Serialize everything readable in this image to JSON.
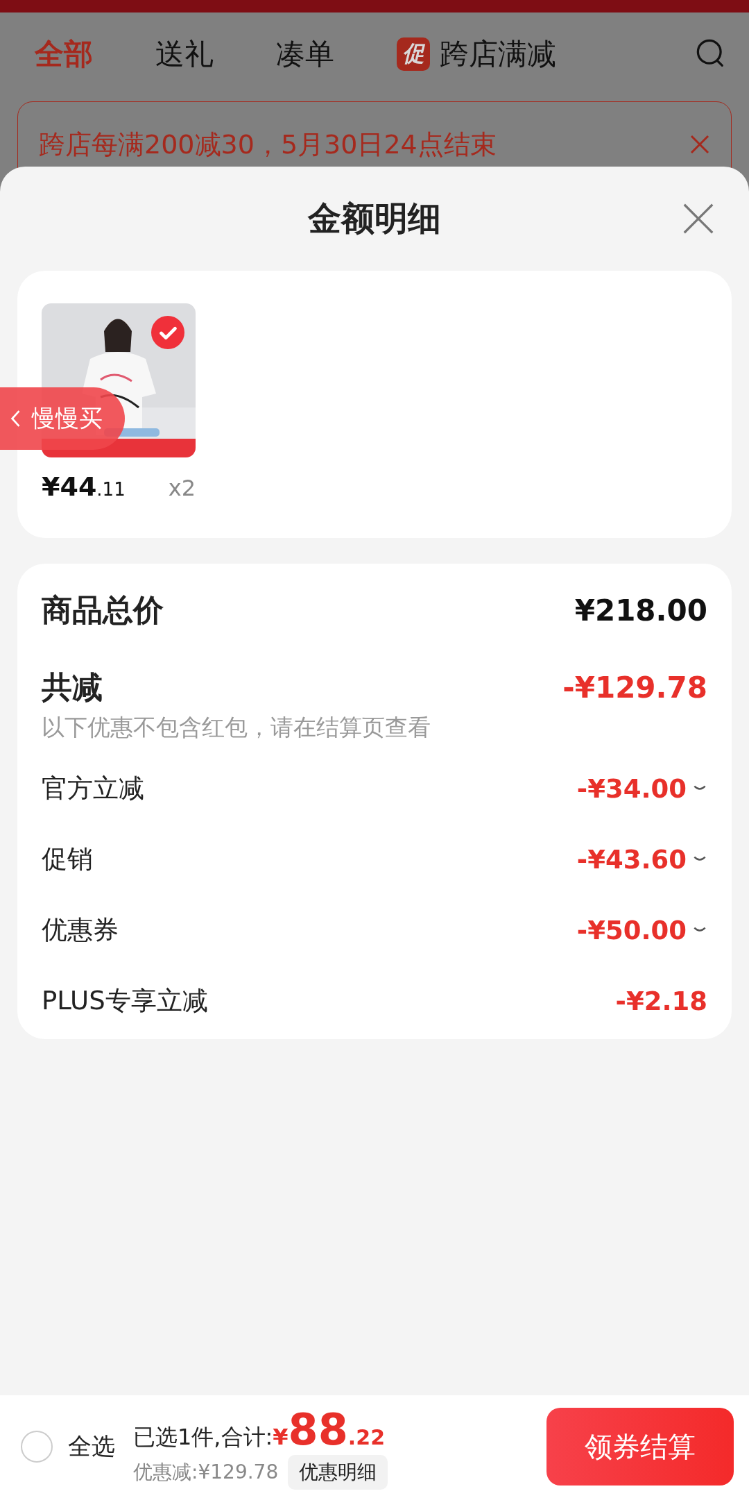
{
  "tabs": [
    {
      "label": "全部",
      "selected": true
    },
    {
      "label": "送礼",
      "selected": false
    },
    {
      "label": "凑单",
      "selected": false
    },
    {
      "label": "跨店满减",
      "selected": false,
      "badge": "促"
    }
  ],
  "promo_banner": {
    "text": "跨店每满200减30，5月30日24点结束"
  },
  "sheet": {
    "title": "金额明细",
    "product": {
      "checked": true,
      "price_main": "¥44",
      "price_decimal": ".11",
      "quantity": "x2",
      "side_tab": "慢慢买"
    },
    "summary": [
      {
        "kind": "total",
        "label": "商品总价",
        "value": "¥218.00"
      },
      {
        "kind": "discount_total",
        "label": "共减",
        "value": "-¥129.78",
        "note": "以下优惠不包含红包，请在结算页查看"
      },
      {
        "kind": "item",
        "label": "官方立减",
        "value": "-¥34.00",
        "expandable": true
      },
      {
        "kind": "item",
        "label": "促销",
        "value": "-¥43.60",
        "expandable": true
      },
      {
        "kind": "item",
        "label": "优惠券",
        "value": "-¥50.00",
        "expandable": true
      },
      {
        "kind": "item",
        "label": "PLUS专享立减",
        "value": "-¥2.18",
        "expandable": false
      }
    ]
  },
  "bottom_bar": {
    "select_all": {
      "label": "全选",
      "checked": false
    },
    "selected_text": "已选1件,合计:",
    "currency": "¥",
    "total_main": "88",
    "total_decimal": ".22",
    "discount_text": "优惠减:¥129.78",
    "detail_button": "优惠明细",
    "checkout_button": "领券结算"
  }
}
